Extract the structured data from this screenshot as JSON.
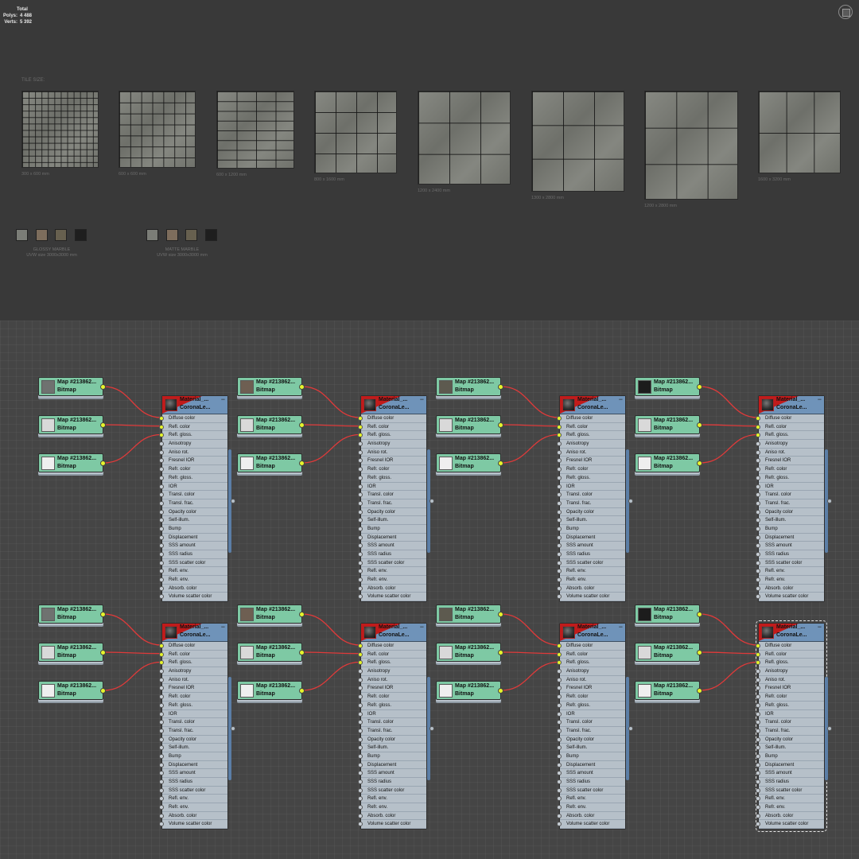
{
  "viewport_stats": {
    "title": "Total",
    "rows": [
      {
        "label": "Polys:",
        "value": "4 488"
      },
      {
        "label": "Verts:",
        "value": "5 392"
      }
    ]
  },
  "tile_size_title": "TILE SIZE:",
  "tiles": [
    {
      "label": "300 x 600 mm"
    },
    {
      "label": "600 x 600 mm"
    },
    {
      "label": "600 x 1200 mm"
    },
    {
      "label": "800 x 1600 mm"
    },
    {
      "label": "1200 x 2400 mm"
    },
    {
      "label": "1300 x 2800 mm"
    },
    {
      "label": "1200 x 2800 mm"
    },
    {
      "label": "1600 x 3200 mm"
    }
  ],
  "swatch_groups": [
    {
      "caption_line1": "GLOSSY MARBLE",
      "caption_line2": "UVW size 3000x3000 mm",
      "swatch_colors": [
        "#7b7d77",
        "#7d6d5c",
        "#67604f",
        "#1e1e1e"
      ]
    },
    {
      "caption_line1": "MATTE MARBLE",
      "caption_line2": "UVW size 3000x3000 mm",
      "swatch_colors": [
        "#7b7d77",
        "#7d6d5c",
        "#67604f",
        "#1e1e1e"
      ]
    }
  ],
  "bitmap_node": {
    "title": "Map #213862...",
    "subtitle": "Bitmap"
  },
  "thumb_colors": {
    "color_maps": [
      "#6f7270",
      "#6e5f52",
      "#5d5a4f",
      "#1c1c1c"
    ],
    "refl_map": "#d9d9d9",
    "gloss_map": "#efefef"
  },
  "material_node": {
    "title": "Material_...",
    "subtitle": "CoronaLe...",
    "collapse": "−"
  },
  "material_slots": [
    "Diffuse color",
    "Refl. color",
    "Refl. gloss.",
    "Anisotropy",
    "Aniso rot.",
    "Fresnel IOR",
    "Refr. color",
    "Refr. gloss.",
    "IOR",
    "Transl. color",
    "Transl. frac.",
    "Opacity color",
    "Self-illum.",
    "Bump",
    "Displacement",
    "SSS amount",
    "SSS radius",
    "SSS scatter color",
    "Refl. env.",
    "Refr. env.",
    "Absorb. color",
    "Volume scatter color"
  ],
  "colors": {
    "wire": "#e03a3a",
    "connector_active": "#e6f52b",
    "bitmap_node_bg": "#7ec9a4",
    "material_header": "#6f93b9",
    "material_flag": "#c11b1b"
  }
}
